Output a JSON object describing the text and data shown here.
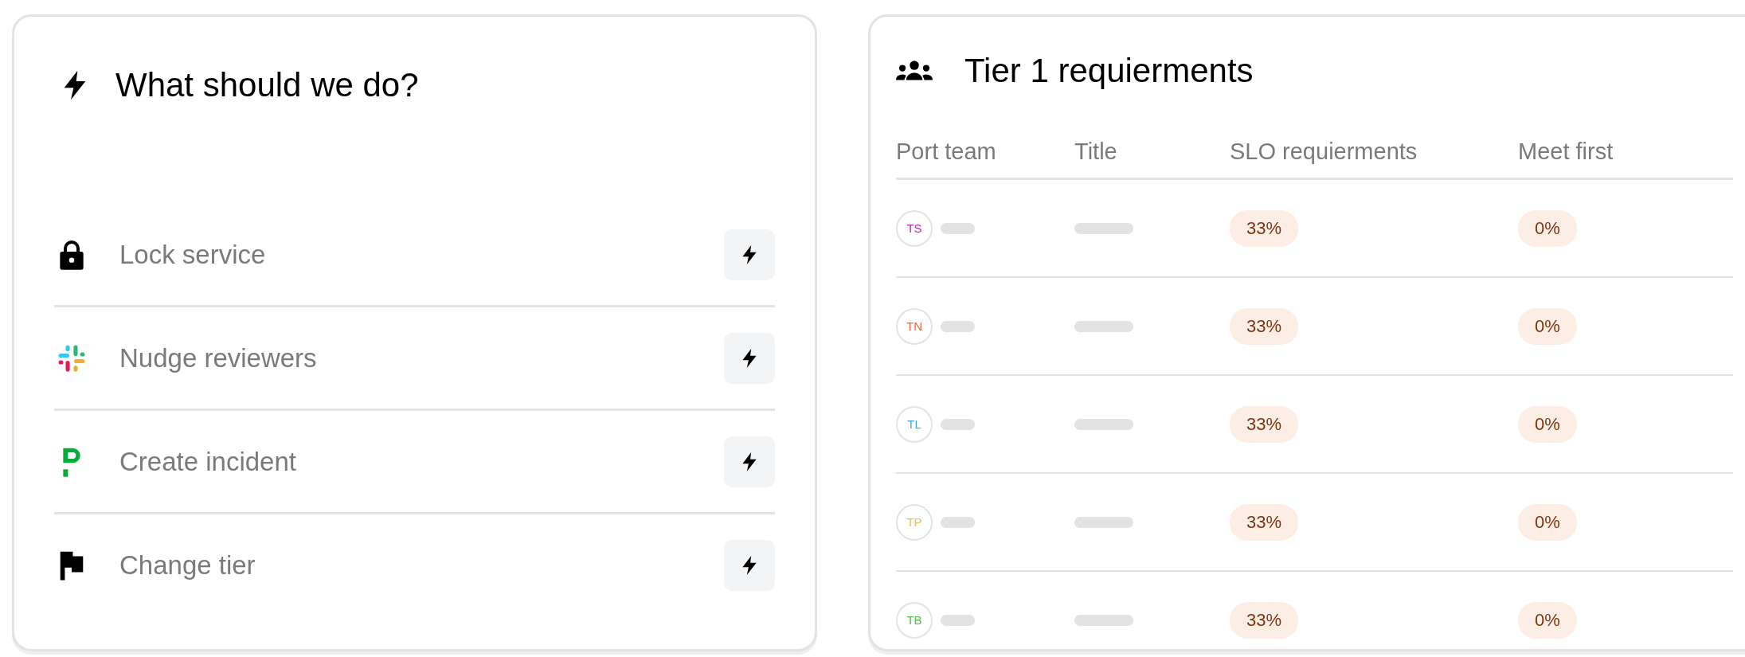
{
  "actions_card": {
    "title": "What should we do?",
    "items": [
      {
        "label": "Lock service"
      },
      {
        "label": "Nudge reviewers"
      },
      {
        "label": "Create incident"
      },
      {
        "label": "Change tier"
      }
    ]
  },
  "requirements_card": {
    "title": "Tier 1 requierments",
    "columns": [
      "Port team",
      "Title",
      "SLO requierments",
      "Meet first"
    ],
    "rows": [
      {
        "initials": "TS",
        "color": "#c21bc2",
        "slo": "33%",
        "meet_first": "0%"
      },
      {
        "initials": "TN",
        "color": "#f0643c",
        "slo": "33%",
        "meet_first": "0%"
      },
      {
        "initials": "TL",
        "color": "#3aa8e8",
        "slo": "33%",
        "meet_first": "0%"
      },
      {
        "initials": "TP",
        "color": "#e8c04a",
        "slo": "33%",
        "meet_first": "0%"
      },
      {
        "initials": "TB",
        "color": "#4cc04c",
        "slo": "33%",
        "meet_first": "0%"
      }
    ]
  }
}
